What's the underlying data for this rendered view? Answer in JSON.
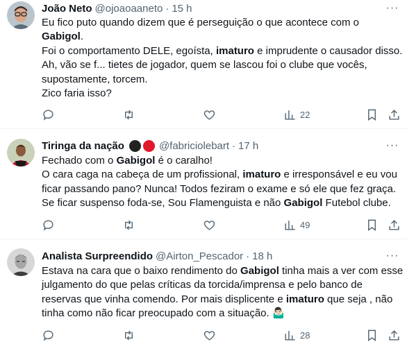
{
  "tweets": [
    {
      "name": "João Neto",
      "handle": "@ojoaoaaneto",
      "time": "15 h",
      "lines": [
        [
          {
            "t": "Eu fico puto quando dizem que é perseguição o que acontece com o"
          }
        ],
        [
          {
            "t": "Gabigol",
            "b": true
          },
          {
            "t": "."
          }
        ],
        [
          {
            "t": "Foi o comportamento DELE, egoísta, "
          },
          {
            "t": "imaturo",
            "b": true
          },
          {
            "t": " e imprudente o causador disso."
          }
        ],
        [
          {
            "t": "Ah, vão se f... tietes de jogador, quem se lascou foi o clube que vocês,"
          }
        ],
        [
          {
            "t": "supostamente, torcem."
          }
        ],
        [
          {
            "t": "Zico faria isso?"
          }
        ]
      ],
      "views": "22",
      "avatar_icon": "man-with-glasses-avatar"
    },
    {
      "name": "Tiringa da nação",
      "handle": "@fabriciolebart",
      "time": "17 h",
      "badge_colors": [
        "#222222",
        "#e0192b"
      ],
      "lines": [
        [
          {
            "t": "Fechado com o "
          },
          {
            "t": "Gabigol",
            "b": true
          },
          {
            "t": " é o caralho!"
          }
        ],
        [
          {
            "t": "O cara caga na cabeça de um profissional, "
          },
          {
            "t": "imaturo",
            "b": true
          },
          {
            "t": " e irresponsável e eu vou"
          }
        ],
        [
          {
            "t": "ficar passando pano? Nunca! Todos feziram o exame e só ele que fez graça."
          }
        ],
        [
          {
            "t": "Se ficar suspenso foda-se, Sou Flamenguista e não "
          },
          {
            "t": "Gabigol",
            "b": true
          },
          {
            "t": " Futebol clube."
          }
        ]
      ],
      "views": "49",
      "avatar_icon": "footballer-avatar"
    },
    {
      "name": "Analista Surpreendido",
      "handle": "@Airton_Pescador",
      "time": "18 h",
      "lines": [
        [
          {
            "t": "Estava na cara que o baixo rendimento do "
          },
          {
            "t": "Gabigol",
            "b": true
          },
          {
            "t": " tinha mais a ver com esse"
          }
        ],
        [
          {
            "t": "julgamento do que pelas críticas da torcida/imprensa e pelo banco de"
          }
        ],
        [
          {
            "t": "reservas que vinha comendo. Por mais displicente e "
          },
          {
            "t": "imaturo",
            "b": true
          },
          {
            "t": " que seja , não"
          }
        ],
        [
          {
            "t": "tinha como não ficar preocupado com a situação. 🤷🏻‍♂️"
          }
        ]
      ],
      "views": "28",
      "avatar_icon": "grayscale-portrait-avatar"
    }
  ],
  "colors": {
    "text": "#0f1419",
    "muted": "#536471",
    "divider": "#eff3f4"
  }
}
